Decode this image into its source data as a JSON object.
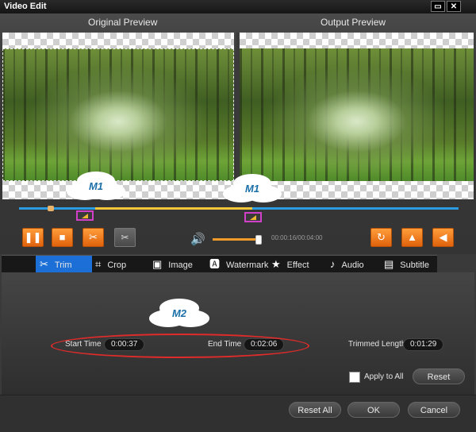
{
  "window": {
    "title": "Video Edit",
    "restore_label": "▭",
    "close_label": "✕"
  },
  "preview": {
    "original_label": "Original Preview",
    "output_label": "Output Preview",
    "annotation_m1_left": "M1",
    "annotation_m1_right": "M1",
    "annotation_m2": "M2"
  },
  "playback": {
    "time": "00:00:16/00:04:00",
    "volume_fraction": 0.92
  },
  "icons": {
    "pause": "pause-icon",
    "stop": "stop-icon",
    "cut": "scissors-icon",
    "cut_disabled": "scissors-icon",
    "volume": "volume-icon",
    "rotate": "rotate-icon",
    "flip_v": "flip-vertical-icon",
    "flip_h": "flip-horizontal-icon"
  },
  "tabs": [
    {
      "label": "Trim",
      "icon": "scissors-icon",
      "active": true
    },
    {
      "label": "Crop",
      "icon": "crop-icon"
    },
    {
      "label": "Image",
      "icon": "image-icon"
    },
    {
      "label": "Watermark",
      "icon": "watermark-icon"
    },
    {
      "label": "Effect",
      "icon": "star-icon"
    },
    {
      "label": "Audio",
      "icon": "music-icon"
    },
    {
      "label": "Subtitle",
      "icon": "subtitle-icon"
    }
  ],
  "trim": {
    "start_label": "Start Time",
    "start_value": "0:00:37",
    "end_label": "End Time",
    "end_value": "0:02:06",
    "length_label": "Trimmed Length",
    "length_value": "0:01:29",
    "apply_all_label": "Apply to All",
    "reset_label": "Reset"
  },
  "footer": {
    "reset_all": "Reset All",
    "ok": "OK",
    "cancel": "Cancel"
  },
  "colors": {
    "accent": "#1b6fd6",
    "orange": "#f07a1c",
    "timeline": "#2c9be0",
    "selection": "#f3c63b",
    "annotation": "#e02b2b"
  }
}
